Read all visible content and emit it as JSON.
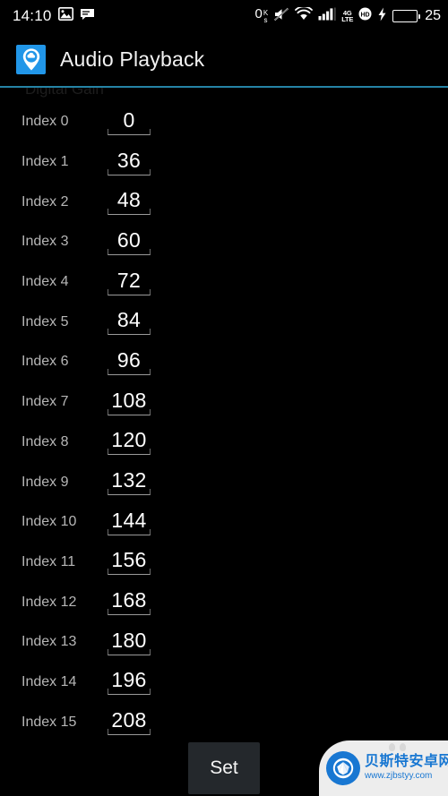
{
  "status_bar": {
    "time": "14:10",
    "icons_left": [
      "image-icon",
      "message-icon"
    ],
    "data_rate": "0",
    "data_rate_unit_top": "K",
    "data_rate_unit_bottom": "s",
    "icons_right": [
      "mute-icon",
      "wifi-icon",
      "signal-bars-icon",
      "4g-lte-icon",
      "hd-call-icon",
      "charging-bolt-icon"
    ],
    "network_label_top": "4G",
    "network_label_bottom": "LTE",
    "hd_label": "HD",
    "battery_percent": "25",
    "battery_color": "#2fd317"
  },
  "action_bar": {
    "title": "Audio Playback",
    "icon": "cloud-pin-app-icon",
    "icon_bg": "#2196e8",
    "divider_color": "#33b5e5"
  },
  "content": {
    "section_title": "Digital Gain",
    "rows": [
      {
        "label": "Index 0",
        "value": "0"
      },
      {
        "label": "Index 1",
        "value": "36"
      },
      {
        "label": "Index 2",
        "value": "48"
      },
      {
        "label": "Index 3",
        "value": "60"
      },
      {
        "label": "Index 4",
        "value": "72"
      },
      {
        "label": "Index 5",
        "value": "84"
      },
      {
        "label": "Index 6",
        "value": "96"
      },
      {
        "label": "Index 7",
        "value": "108"
      },
      {
        "label": "Index 8",
        "value": "120"
      },
      {
        "label": "Index 9",
        "value": "132"
      },
      {
        "label": "Index 10",
        "value": "144"
      },
      {
        "label": "Index 11",
        "value": "156"
      },
      {
        "label": "Index 12",
        "value": "168"
      },
      {
        "label": "Index 13",
        "value": "180"
      },
      {
        "label": "Index 14",
        "value": "196"
      },
      {
        "label": "Index 15",
        "value": "208"
      }
    ]
  },
  "footer": {
    "set_button_label": "Set"
  },
  "watermark": {
    "site_name": "贝斯特安卓网",
    "url": "www.zjbstyy.com",
    "accent": "#1877d2"
  }
}
